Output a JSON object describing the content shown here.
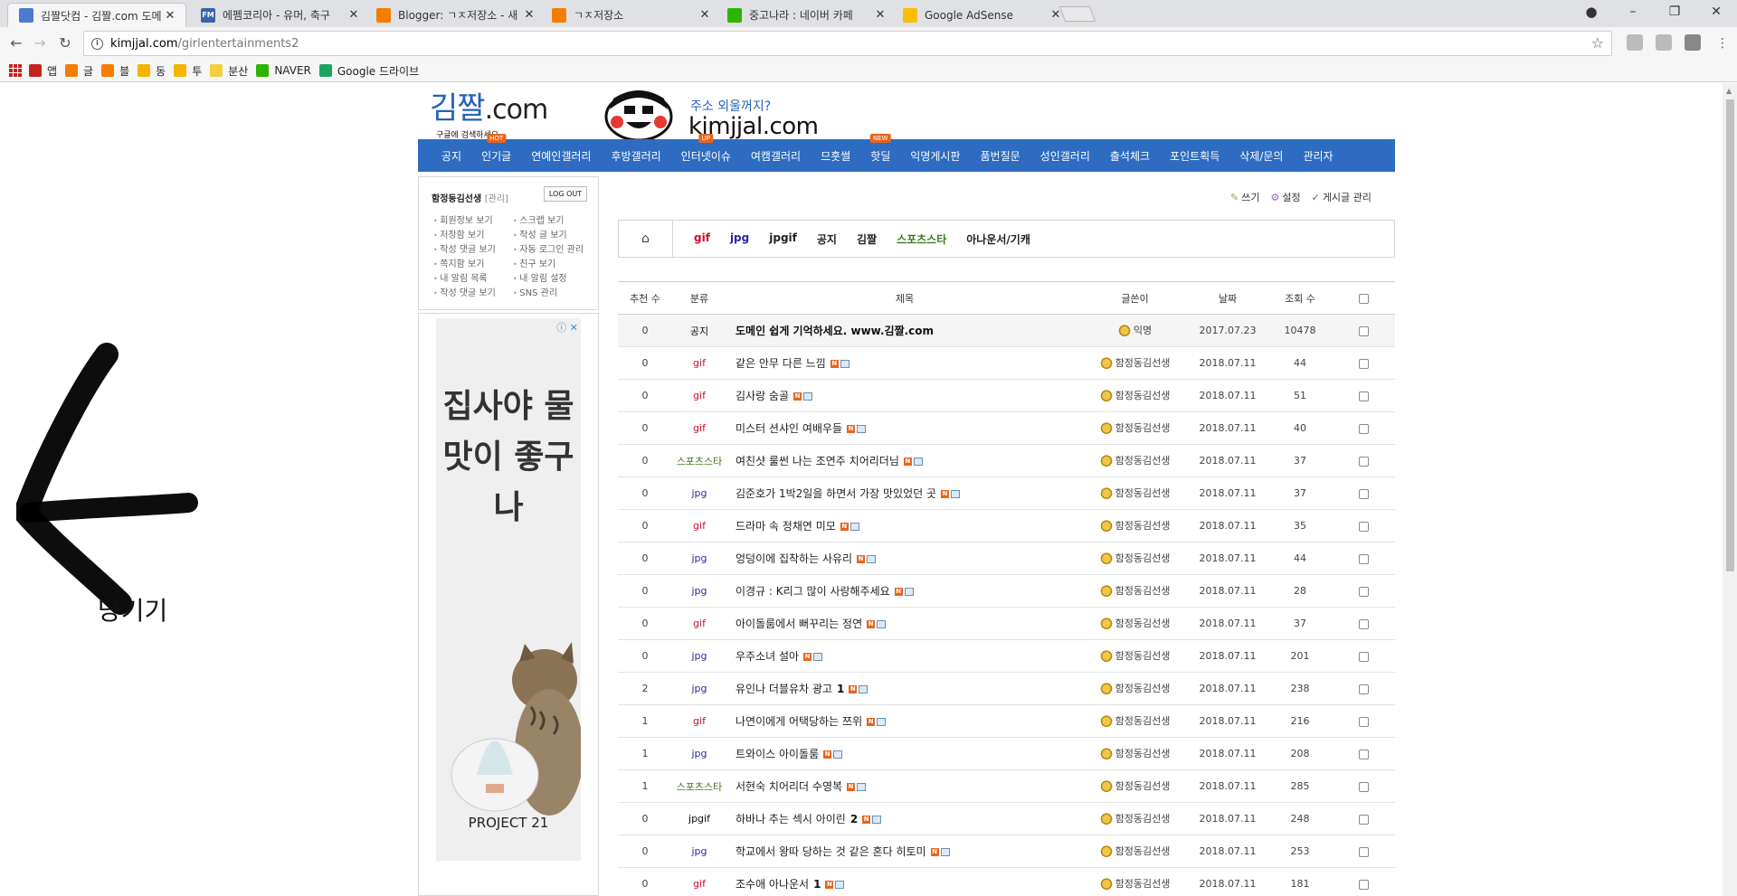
{
  "browser": {
    "tabs": [
      {
        "title": "김짤닷컴 - 김짤.com 도메",
        "favicon_color": "#4a7bd0",
        "active": true
      },
      {
        "title": "에펨코리아 - 유머, 축구",
        "favicon_color": "#3a64a8",
        "favicon_text": "FM",
        "active": false
      },
      {
        "title": "Blogger: ㄱㅈ저장소 - 새",
        "favicon_color": "#f57d00",
        "active": false
      },
      {
        "title": "ㄱㅈ저장소",
        "favicon_color": "#f57d00",
        "active": false
      },
      {
        "title": "중고나라 : 네이버 카페",
        "favicon_color": "#2db400",
        "active": false
      },
      {
        "title": "Google AdSense",
        "favicon_color": "#fbbc04",
        "active": false
      }
    ],
    "url_domain": "kimjjal.com",
    "url_path": "/girlentertainments2",
    "bookmarks": [
      {
        "label": "앱",
        "color": "#c5221f"
      },
      {
        "label": "글",
        "color": "#f57d00"
      },
      {
        "label": "블",
        "color": "#f57d00"
      },
      {
        "label": "동",
        "color": "#f4b400"
      },
      {
        "label": "투",
        "color": "#f4b400"
      },
      {
        "label": "분산",
        "color": "#f4d03f"
      },
      {
        "label": "NAVER",
        "color": "#2db400"
      },
      {
        "label": "Google 드라이브",
        "color": "#1fa463"
      }
    ]
  },
  "overlay": {
    "pull_text": "당기기"
  },
  "site": {
    "logo_main": "김짤",
    "logo_com": ".com",
    "logo_sub": "구글에 검색하세요",
    "banner_question": "주소 외울꺼지?",
    "banner_url": "kimjjal.com",
    "nav": [
      {
        "label": "공지",
        "badge": ""
      },
      {
        "label": "인기글",
        "badge": "HOT"
      },
      {
        "label": "연예인갤러리",
        "badge": ""
      },
      {
        "label": "후방갤러리",
        "badge": ""
      },
      {
        "label": "인터넷이슈",
        "badge": "UP"
      },
      {
        "label": "여캠갤러리",
        "badge": ""
      },
      {
        "label": "므흣썰",
        "badge": ""
      },
      {
        "label": "핫딜",
        "badge": "NEW"
      },
      {
        "label": "익명게시판",
        "badge": ""
      },
      {
        "label": "품번질문",
        "badge": ""
      },
      {
        "label": "성인갤러리",
        "badge": ""
      },
      {
        "label": "출석체크",
        "badge": ""
      },
      {
        "label": "포인트획득",
        "badge": ""
      },
      {
        "label": "삭제/문의",
        "badge": ""
      },
      {
        "label": "관리자",
        "badge": ""
      }
    ]
  },
  "login": {
    "username": "함정동김선생",
    "admin": "[관리]",
    "logout": "LOG OUT",
    "links": [
      "회원정보 보기",
      "스크랩 보기",
      "저장함 보기",
      "작성 글 보기",
      "작성 댓글 보기",
      "자동 로그인 관리",
      "쪽지함 보기",
      "친구 보기",
      "내 알림 목록",
      "내 알림 설정",
      "작성 댓글 보기",
      "SNS 관리"
    ]
  },
  "ad": {
    "adchoices": "ⓘ ✕",
    "headline": "집사야 물맛이 좋구나",
    "brand": "PROJECT 21"
  },
  "board": {
    "actions": [
      "쓰기",
      "설정",
      "게시글 관리"
    ],
    "categories": [
      {
        "label": "gif",
        "color": "#c8102e"
      },
      {
        "label": "jpg",
        "color": "#2a2a9a"
      },
      {
        "label": "jpgif",
        "color": "#222"
      },
      {
        "label": "공지",
        "color": "#222"
      },
      {
        "label": "김짤",
        "color": "#222"
      },
      {
        "label": "스포츠스타",
        "color": "#3c7a1f"
      },
      {
        "label": "아나운서/기캐",
        "color": "#222"
      }
    ],
    "columns": [
      "추천 수",
      "분류",
      "제목",
      "글쓴이",
      "날짜",
      "조회 수"
    ],
    "rows": [
      {
        "votes": "0",
        "cat": "공지",
        "cat_color": "#111",
        "title": "도메인 쉽게 기억하세요. www.김짤.com",
        "comments": "",
        "writer": "익명",
        "date": "2017.07.23",
        "views": "10478",
        "notice": true
      },
      {
        "votes": "0",
        "cat": "gif",
        "cat_color": "#c8102e",
        "title": "같은 안무 다른 느낌",
        "comments": "",
        "writer": "함정동김선생",
        "date": "2018.07.11",
        "views": "44"
      },
      {
        "votes": "0",
        "cat": "gif",
        "cat_color": "#c8102e",
        "title": "김사랑 숨골",
        "comments": "",
        "writer": "함정동김선생",
        "date": "2018.07.11",
        "views": "51"
      },
      {
        "votes": "0",
        "cat": "gif",
        "cat_color": "#c8102e",
        "title": "미스터 션샤인 여배우들",
        "comments": "",
        "writer": "함정동김선생",
        "date": "2018.07.11",
        "views": "40"
      },
      {
        "votes": "0",
        "cat": "스포츠스타",
        "cat_color": "#3c7a1f",
        "title": "여친샷 룰썬 나는 조연주 치어리더님",
        "comments": "",
        "writer": "함정동김선생",
        "date": "2018.07.11",
        "views": "37"
      },
      {
        "votes": "0",
        "cat": "jpg",
        "cat_color": "#2a2a9a",
        "title": "김준호가 1박2일을 하면서 가장 맛있었던 곳",
        "comments": "",
        "writer": "함정동김선생",
        "date": "2018.07.11",
        "views": "37"
      },
      {
        "votes": "0",
        "cat": "gif",
        "cat_color": "#c8102e",
        "title": "드라마 속 정채연 미모",
        "comments": "",
        "writer": "함정동김선생",
        "date": "2018.07.11",
        "views": "35"
      },
      {
        "votes": "0",
        "cat": "jpg",
        "cat_color": "#2a2a9a",
        "title": "엉덩이에 집착하는 사유리",
        "comments": "",
        "writer": "함정동김선생",
        "date": "2018.07.11",
        "views": "44"
      },
      {
        "votes": "0",
        "cat": "jpg",
        "cat_color": "#2a2a9a",
        "title": "이경규 : K리그 많이 사랑해주세요",
        "comments": "",
        "writer": "함정동김선생",
        "date": "2018.07.11",
        "views": "28"
      },
      {
        "votes": "0",
        "cat": "gif",
        "cat_color": "#c8102e",
        "title": "아이돌룸에서 뻐꾸리는 정연",
        "comments": "",
        "writer": "함정동김선생",
        "date": "2018.07.11",
        "views": "37"
      },
      {
        "votes": "0",
        "cat": "jpg",
        "cat_color": "#2a2a9a",
        "title": "우주소녀 설아",
        "comments": "",
        "writer": "함정동김선생",
        "date": "2018.07.11",
        "views": "201"
      },
      {
        "votes": "2",
        "cat": "jpg",
        "cat_color": "#2a2a9a",
        "title": "유인나 더블유차 광고",
        "comments": "1",
        "writer": "함정동김선생",
        "date": "2018.07.11",
        "views": "238"
      },
      {
        "votes": "1",
        "cat": "gif",
        "cat_color": "#c8102e",
        "title": "나연이에게 어택당하는 쯔위",
        "comments": "",
        "writer": "함정동김선생",
        "date": "2018.07.11",
        "views": "216"
      },
      {
        "votes": "1",
        "cat": "jpg",
        "cat_color": "#2a2a9a",
        "title": "트와이스 아이돌룸",
        "comments": "",
        "writer": "함정동김선생",
        "date": "2018.07.11",
        "views": "208"
      },
      {
        "votes": "1",
        "cat": "스포츠스타",
        "cat_color": "#3c7a1f",
        "title": "서현숙 치어리더 수영복",
        "comments": "",
        "writer": "함정동김선생",
        "date": "2018.07.11",
        "views": "285"
      },
      {
        "votes": "0",
        "cat": "jpgif",
        "cat_color": "#111",
        "title": "하바나 추는 섹시 아이린",
        "comments": "2",
        "writer": "함정동김선생",
        "date": "2018.07.11",
        "views": "248"
      },
      {
        "votes": "0",
        "cat": "jpg",
        "cat_color": "#2a2a9a",
        "title": "학교에서 왕따 당하는 것 같은 혼다 히토미",
        "comments": "",
        "writer": "함정동김선생",
        "date": "2018.07.11",
        "views": "253"
      },
      {
        "votes": "0",
        "cat": "gif",
        "cat_color": "#c8102e",
        "title": "조수애 아나운서",
        "comments": "1",
        "writer": "함정동김선생",
        "date": "2018.07.11",
        "views": "181"
      }
    ]
  }
}
